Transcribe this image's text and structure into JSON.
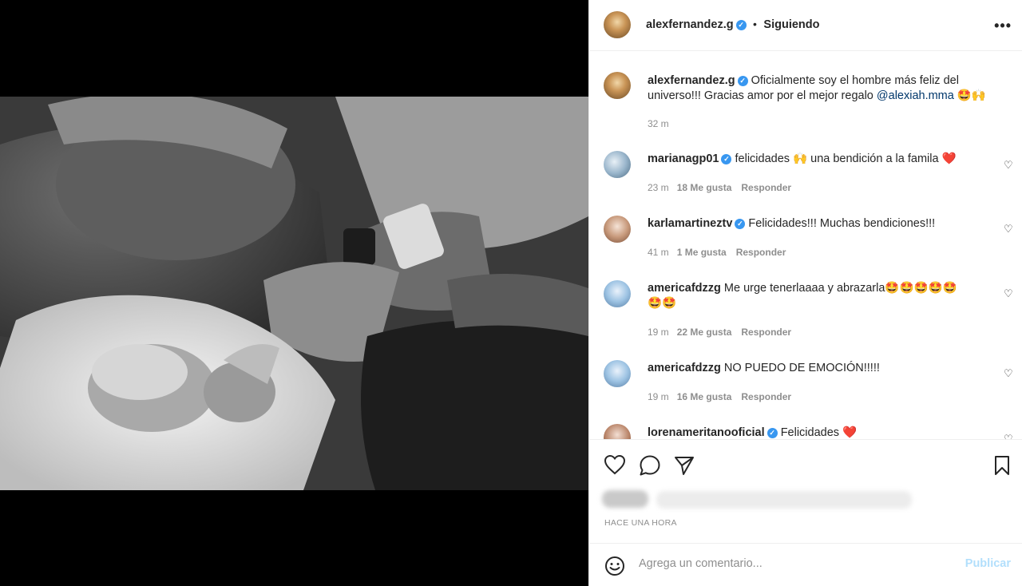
{
  "post": {
    "username": "alexfernandez.g",
    "follow_status": "Siguiendo",
    "caption_user": "alexfernandez.g",
    "caption_text": "Oficialmente soy el hombre más feliz del universo!!! Gracias amor por el mejor regalo",
    "caption_mention": "@alexiah.mma",
    "caption_emojis": "🤩🙌",
    "caption_time": "32 m",
    "time_ago": "HACE UNA HORA"
  },
  "comments": [
    {
      "user": "marianagp01",
      "text": "felicidades 🙌 una bendición a la famila ❤️",
      "time": "23 m",
      "likes": "18 Me gusta",
      "reply": "Responder"
    },
    {
      "user": "karlamartineztv",
      "text": "Felicidades!!! Muchas bendiciones!!!",
      "time": "41 m",
      "likes": "1 Me gusta",
      "reply": "Responder"
    },
    {
      "user": "americafdzzg",
      "text": "Me urge tenerlaaaa y abrazarla🤩🤩🤩🤩🤩",
      "text2": "🤩🤩",
      "time": "19 m",
      "likes": "22 Me gusta",
      "reply": "Responder"
    },
    {
      "user": "americafdzzg",
      "text": "NO PUEDO DE EMOCIÓN!!!!!",
      "time": "19 m",
      "likes": "16 Me gusta",
      "reply": "Responder"
    },
    {
      "user": "lorenameritanooficial",
      "text": "Felicidades ❤️"
    }
  ],
  "add_comment": {
    "placeholder": "Agrega un comentario...",
    "publish_label": "Publicar"
  },
  "icons": {
    "more": "more-options-icon",
    "like": "heart-icon",
    "comment": "comment-icon",
    "share": "share-icon",
    "save": "bookmark-icon",
    "emoji": "emoji-icon"
  },
  "colors": {
    "verified": "#3897f0",
    "mention": "#00376b",
    "publish": "#b2dffc"
  }
}
